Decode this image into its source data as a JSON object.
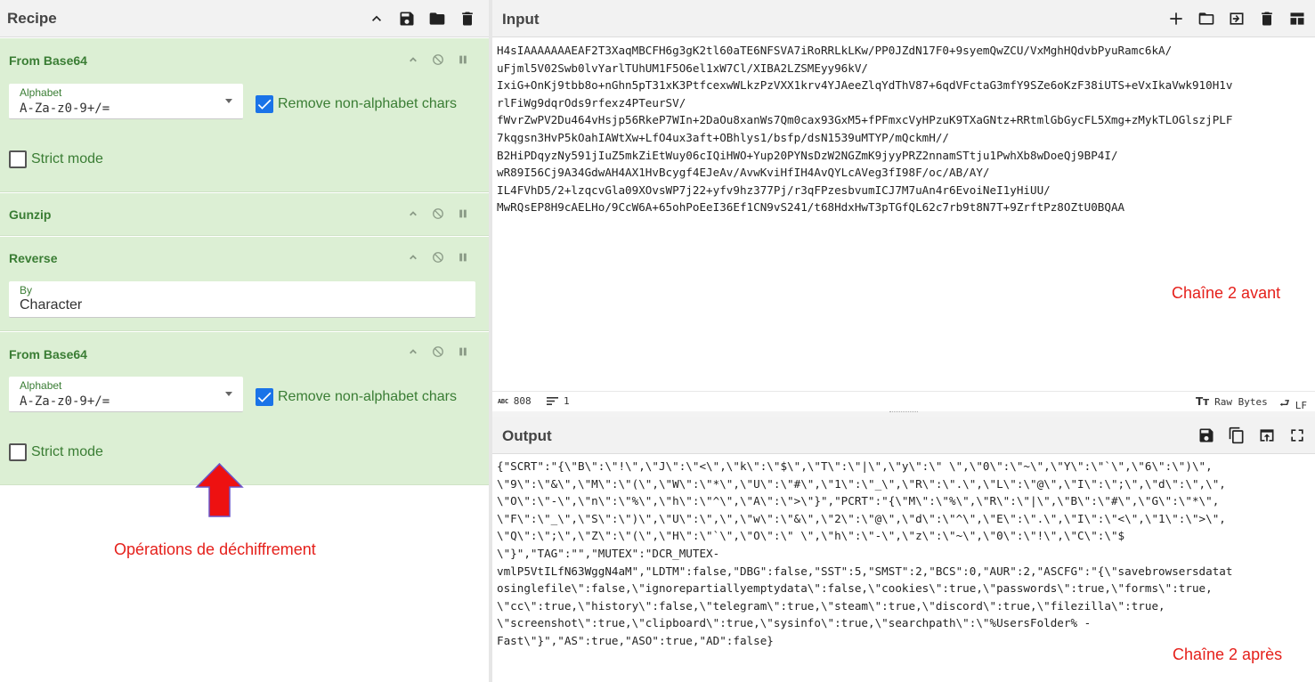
{
  "recipe": {
    "title": "Recipe",
    "operations": [
      {
        "name": "From Base64",
        "alphabet_label": "Alphabet",
        "alphabet_value": "A-Za-z0-9+/=",
        "remove_non_alphabet_label": "Remove non-alphabet chars",
        "remove_non_alphabet_checked": true,
        "strict_mode_label": "Strict mode",
        "strict_mode_checked": false
      },
      {
        "name": "Gunzip"
      },
      {
        "name": "Reverse",
        "by_label": "By",
        "by_value": "Character"
      },
      {
        "name": "From Base64",
        "alphabet_label": "Alphabet",
        "alphabet_value": "A-Za-z0-9+/=",
        "remove_non_alphabet_label": "Remove non-alphabet chars",
        "remove_non_alphabet_checked": true,
        "strict_mode_label": "Strict mode",
        "strict_mode_checked": false
      }
    ],
    "annotation": "Opérations de déchiffrement"
  },
  "input": {
    "title": "Input",
    "text": "H4sIAAAAAAAEAF2T3XaqMBCFH6g3gK2tl60aTE6NFSVA7iRoRRLkLKw/PP0JZdN17F0+9syemQwZCU/VxMghHQdvbPyuRamc6kA/\nuFjml5V02Swb0lvYarlTUhUM1F5O6el1xW7Cl/XIBA2LZSMEyy96kV/\nIxiG+OnKj9tbb8o+nGhn5pT31xK3PtfcexwWLkzPzVXX1krv4YJAeeZlqYdThV87+6qdVFctaG3mfY9SZe6oKzF38iUTS+eVxIkaVwk910H1v\nrlFiWg9dqrOds9rfexz4PTeurSV/\nfWvrZwPV2Du464vHsjp56RkeP7WIn+2DaOu8xanWs7Qm0cax93GxM5+fPFmxcVyHPzuK9TXaGNtz+RRtmlGbGycFL5Xmg+zMykTLOGlszjPLF\n7kqgsn3HvP5kOahIAWtXw+LfO4ux3aft+OBhlys1/bsfp/dsN1539uMTYP/mQckmH//\nB2HiPDqyzNy591jIuZ5mkZiEtWuy06cIQiHWO+Yup20PYNsDzW2NGZmK9jyyPRZ2nnamSTtju1PwhXb8wDoeQj9BP4I/\nwR89I56Cj9A34GdwAH4AX1HvBcygf4EJeAv/AvwKviHfIH4AvQYLcAVeg3fI98F/oc/AB/AY/\nIL4FVhD5/2+lzqcvGla09XOvsWP7j22+yfv9hz377Pj/r3qFPzesbvumICJ7M7uAn4r6EvoiNeI1yHiUU/\nMwRQsEP8H9cAELHo/9CcW6A+65ohPoEeI36Ef1CN9vS241/t68HdxHwT3pTGfQL62c7rb9t8N7T+9ZrftPz8OZtU0BQAA",
    "annotation": "Chaîne 2 avant",
    "status": {
      "length_tag": "ABC",
      "length": "808",
      "lines": "1",
      "encoding": "Raw Bytes",
      "eol": "LF"
    }
  },
  "output": {
    "title": "Output",
    "text": "{\"SCRT\":\"{\\\"B\\\":\\\"!\\\",\\\"J\\\":\\\"<\\\",\\\"k\\\":\\\"$\\\",\\\"T\\\":\\\"|\\\",\\\"y\\\":\\\" \\\",\\\"0\\\":\\\"~\\\",\\\"Y\\\":\\\"`\\\",\\\"6\\\":\\\")\\\",\n\\\"9\\\":\\\"&\\\",\\\"M\\\":\\\"(\\\",\\\"W\\\":\\\"*\\\",\\\"U\\\":\\\"#\\\",\\\"1\\\":\\\"_\\\",\\\"R\\\":\\\".\\\",\\\"L\\\":\\\"@\\\",\\\"I\\\":\\\";\\\",\\\"d\\\":\\\",\\\",\n\\\"O\\\":\\\"-\\\",\\\"n\\\":\\\"%\\\",\\\"h\\\":\\\"^\\\",\\\"A\\\":\\\">\\\"}\",\"PCRT\":\"{\\\"M\\\":\\\"%\\\",\\\"R\\\":\\\"|\\\",\\\"B\\\":\\\"#\\\",\\\"G\\\":\\\"*\\\",\n\\\"F\\\":\\\"_\\\",\\\"S\\\":\\\")\\\",\\\"U\\\":\\\",\\\",\\\"w\\\":\\\"&\\\",\\\"2\\\":\\\"@\\\",\\\"d\\\":\\\"^\\\",\\\"E\\\":\\\".\\\",\\\"I\\\":\\\"<\\\",\\\"1\\\":\\\">\\\",\n\\\"Q\\\":\\\";\\\",\\\"Z\\\":\\\"(\\\",\\\"H\\\":\\\"`\\\",\\\"O\\\":\\\" \\\",\\\"h\\\":\\\"-\\\",\\\"z\\\":\\\"~\\\",\\\"0\\\":\\\"!\\\",\\\"C\\\":\\\"$\n\\\"}\",\"TAG\":\"\",\"MUTEX\":\"DCR_MUTEX-\nvmlP5VtILfN63WggN4aM\",\"LDTM\":false,\"DBG\":false,\"SST\":5,\"SMST\":2,\"BCS\":0,\"AUR\":2,\"ASCFG\":\"{\\\"savebrowsersdatat\nosinglefile\\\":false,\\\"ignorepartiallyemptydata\\\":false,\\\"cookies\\\":true,\\\"passwords\\\":true,\\\"forms\\\":true,\n\\\"cc\\\":true,\\\"history\\\":false,\\\"telegram\\\":true,\\\"steam\\\":true,\\\"discord\\\":true,\\\"filezilla\\\":true,\n\\\"screenshot\\\":true,\\\"clipboard\\\":true,\\\"sysinfo\\\":true,\\\"searchpath\\\":\\\"%UsersFolder% -\nFast\\\"}\",\"AS\":true,\"ASO\":true,\"AD\":false}",
    "annotation": "Chaîne 2 après"
  },
  "colors": {
    "op_background": "#dcefd4",
    "op_title": "#3a7d34",
    "annotation_red": "#e5201b",
    "checkbox_blue": "#1a73e8",
    "arrow_red": "#ee1111"
  }
}
